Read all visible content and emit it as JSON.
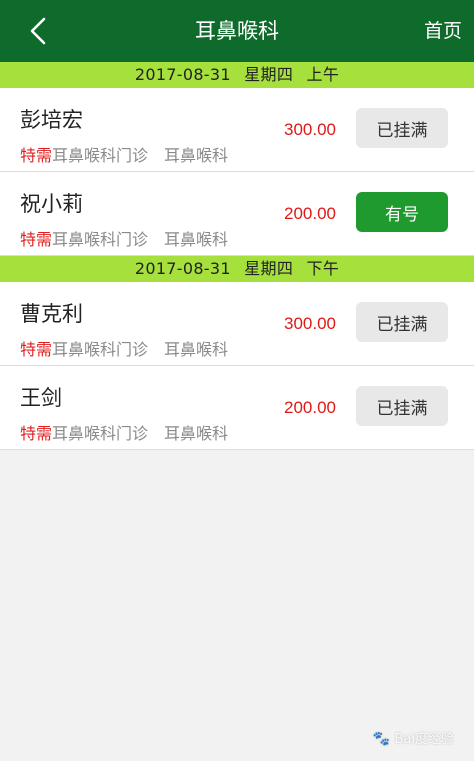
{
  "header": {
    "title": "耳鼻喉科",
    "home_label": "首页",
    "back_icon": "chevron-left-icon"
  },
  "sections": [
    {
      "date": "2017-08-31",
      "weekday": "星期四",
      "period": "上午",
      "rows": [
        {
          "name": "彭培宏",
          "tag": "特需",
          "dept": "耳鼻喉科门诊",
          "dept_sub": "耳鼻喉科",
          "fee": "300.00",
          "status": "已挂满",
          "available": false
        },
        {
          "name": "祝小莉",
          "tag": "特需",
          "dept": "耳鼻喉科门诊",
          "dept_sub": "耳鼻喉科",
          "fee": "200.00",
          "status": "有号",
          "available": true
        }
      ]
    },
    {
      "date": "2017-08-31",
      "weekday": "星期四",
      "period": "下午",
      "rows": [
        {
          "name": "曹克利",
          "tag": "特需",
          "dept": "耳鼻喉科门诊",
          "dept_sub": "耳鼻喉科",
          "fee": "300.00",
          "status": "已挂满",
          "available": false
        },
        {
          "name": "王剑",
          "tag": "特需",
          "dept": "耳鼻喉科门诊",
          "dept_sub": "耳鼻喉科",
          "fee": "200.00",
          "status": "已挂满",
          "available": false
        }
      ]
    }
  ],
  "watermark": "Bai度经验",
  "colors": {
    "header_bg": "#0f6b2c",
    "section_bar": "#a6e03c",
    "fee_red": "#e01818",
    "available_green": "#1f9a2e"
  }
}
